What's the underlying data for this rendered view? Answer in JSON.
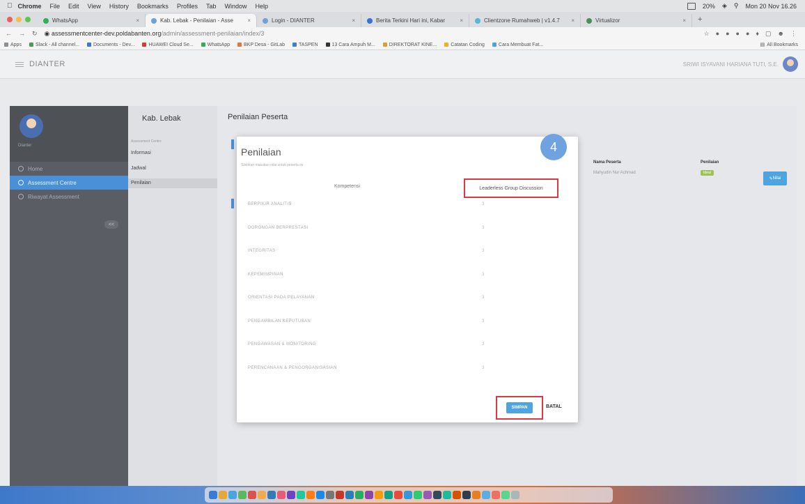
{
  "menubar": {
    "app": "Chrome",
    "items": [
      "File",
      "Edit",
      "View",
      "History",
      "Bookmarks",
      "Profiles",
      "Tab",
      "Window",
      "Help"
    ],
    "battery": "20%",
    "clock": "Mon 20 Nov 16.26"
  },
  "tabs": [
    {
      "title": "WhatsApp"
    },
    {
      "title": "Kab. Lebak - Penilaian - Asse"
    },
    {
      "title": "Login - DIANTER"
    },
    {
      "title": "Berita Terkini Hari ini, Kabar"
    },
    {
      "title": "Clientzone Rumahweb | v1.4.7"
    },
    {
      "title": "Virtualizor"
    }
  ],
  "address": {
    "host": "assessmentcenter-dev.poldabanten.org",
    "path": "/admin/assessment-penilaian/index/3"
  },
  "bookmarks": [
    {
      "label": "Apps",
      "color": "#8a8f98"
    },
    {
      "label": "Slack - All channel...",
      "color": "#4a9d5c"
    },
    {
      "label": "Documents - Dev...",
      "color": "#3b78d8"
    },
    {
      "label": "HUAWEI Cloud Se...",
      "color": "#d8383b"
    },
    {
      "label": "WhatsApp",
      "color": "#2fb055"
    },
    {
      "label": "BKP Desa - GitLab",
      "color": "#e2763b"
    },
    {
      "label": "TASPEN",
      "color": "#3f7fd0"
    },
    {
      "label": "13 Cara Ampuh M...",
      "color": "#333"
    },
    {
      "label": "DIREKTORAT KINE...",
      "color": "#d8a032"
    },
    {
      "label": "Catatan Coding",
      "color": "#e8b32c"
    },
    {
      "label": "Cara Membuat Fat...",
      "color": "#4aa4e0"
    }
  ],
  "bookmarks_all": "All Bookmarks",
  "app": {
    "brand": "DIANTER",
    "user_name": "SRIWI ISYAVANI HARIANA TUTI, S.E."
  },
  "sidebar": {
    "user_caption": "Dianter",
    "items": [
      {
        "label": "Home",
        "active": false
      },
      {
        "label": "Assessment Centre",
        "active": true
      },
      {
        "label": "Riwayat Assessment",
        "active": false
      }
    ],
    "collapse_label": "<<"
  },
  "subnav": {
    "title": "Kab. Lebak",
    "caption": "Assessment Centre",
    "items": [
      {
        "label": "Informasi",
        "active": false
      },
      {
        "label": "Jadwal",
        "active": false
      },
      {
        "label": "Penilaian",
        "active": true
      }
    ]
  },
  "page_title": "Penilaian Peserta",
  "table": {
    "headers": [
      "Nama Peserta",
      "Penilaian"
    ],
    "rows": [
      {
        "name": "Mahyudin Nur Achmad",
        "status": "Ideal"
      }
    ],
    "action_label": "Nilai"
  },
  "modal": {
    "title": "Penilaian",
    "subtitle": "Silahkan masukan nilai untuk peserta ini",
    "step": "4",
    "col_kompetensi": "Kompetensi",
    "col_method": "Leaderless Group Discussion",
    "competencies": [
      {
        "name": "BERPIKIR ANALITIS",
        "value": "3"
      },
      {
        "name": "DORONGAN BERPRESTASI",
        "value": "3"
      },
      {
        "name": "INTEGRITAS",
        "value": "3"
      },
      {
        "name": "KEPEMIMPINAN",
        "value": "3"
      },
      {
        "name": "ORIENTASI PADA PELAYANAN",
        "value": "3"
      },
      {
        "name": "PENGAMBILAN KEPUTUSAN",
        "value": "3"
      },
      {
        "name": "PENGAWASAN & MONITORING",
        "value": "3"
      },
      {
        "name": "PERENCANAAN & PENGORGANISASIAN",
        "value": "3"
      }
    ],
    "save_label": "SIMPAN",
    "cancel_label": "BATAL"
  },
  "colors": {
    "accent": "#4fa3e0",
    "highlight": "#e03545",
    "sidebar": "#5a5d63",
    "step_badge": "#6fa3df"
  }
}
